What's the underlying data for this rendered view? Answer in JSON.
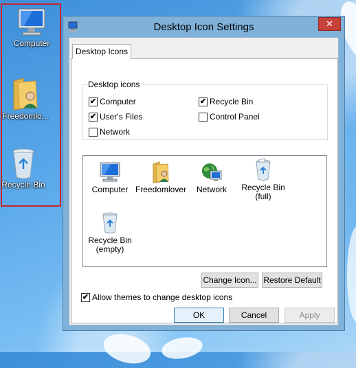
{
  "desktop": {
    "icons": [
      {
        "label": "Computer",
        "icon": "computer-icon"
      },
      {
        "label": "Freedomlo...",
        "icon": "user-folder-icon"
      },
      {
        "label": "Recycle Bin",
        "icon": "recycle-bin-icon"
      }
    ]
  },
  "dialog": {
    "title": "Desktop Icon Settings",
    "close_glyph": "✕",
    "tab_label": "Desktop Icons",
    "group_label": "Desktop icons",
    "checkboxes": [
      {
        "label": "Computer",
        "checked": true
      },
      {
        "label": "Recycle Bin",
        "checked": true
      },
      {
        "label": "User's Files",
        "checked": true
      },
      {
        "label": "Control Panel",
        "checked": false
      },
      {
        "label": "Network",
        "checked": false
      }
    ],
    "list_items": [
      {
        "label": "Computer",
        "icon": "computer-icon"
      },
      {
        "label": "Freedomlover",
        "icon": "user-folder-icon"
      },
      {
        "label": "Network",
        "icon": "network-icon"
      },
      {
        "label": "Recycle Bin (full)",
        "icon": "recycle-bin-full-icon"
      },
      {
        "label": "Recycle Bin (empty)",
        "icon": "recycle-bin-empty-icon"
      }
    ],
    "change_icon_label": "Change Icon...",
    "restore_default_label": "Restore Default",
    "allow_themes": {
      "label": "Allow themes to change desktop icons",
      "checked": true
    },
    "ok_label": "OK",
    "cancel_label": "Cancel",
    "apply_label": "Apply"
  },
  "colors": {
    "selection_border": "#c0282d",
    "close_button": "#c7413b",
    "dialog_frame": "#7fb1d9"
  }
}
